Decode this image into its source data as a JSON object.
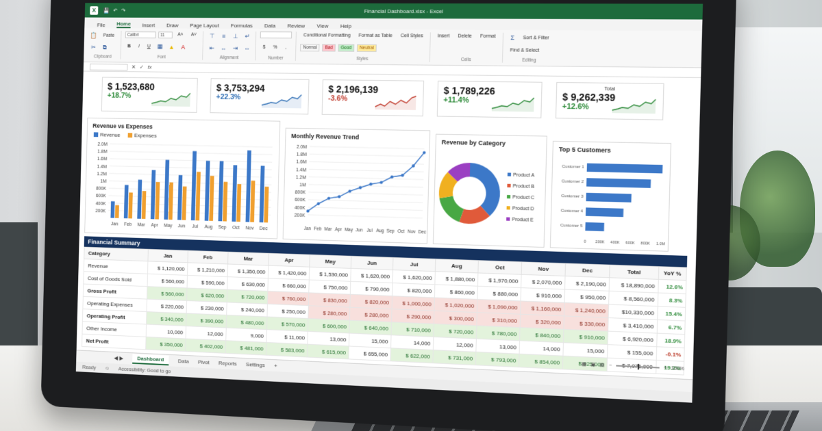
{
  "window": {
    "doc_title": "Financial Dashboard.xlsx - Excel",
    "qa_icons": [
      "save-icon",
      "undo-icon",
      "redo-icon"
    ]
  },
  "menu": [
    "File",
    "Home",
    "Insert",
    "Draw",
    "Page Layout",
    "Formulas",
    "Data",
    "Review",
    "View",
    "Help"
  ],
  "ribbon": {
    "font_name": "Calibri",
    "font_size": "11",
    "clipboard_label": "Clipboard",
    "font_label": "Font",
    "paste_label": "Paste",
    "alignment_label": "Alignment",
    "number_label": "Number",
    "styles_label": "Styles",
    "cells_label": "Cells",
    "editing_label": "Editing",
    "conditional": "Conditional Formatting",
    "format_table": "Format as Table",
    "cell_styles": "Cell Styles",
    "style_normal": "Normal",
    "style_bad": "Bad",
    "style_good": "Good",
    "style_neutral": "Neutral",
    "insert": "Insert",
    "delete": "Delete",
    "format": "Format",
    "sort": "Sort & Filter",
    "find": "Find & Select"
  },
  "formula_bar": {
    "fx": "fx"
  },
  "kpis": [
    {
      "title": "",
      "value": "$ 1,523,680",
      "change": "+18.7%",
      "trend": "up"
    },
    {
      "title": "",
      "value": "$ 3,753,294",
      "change": "+22.3%",
      "trend": "up"
    },
    {
      "title": "",
      "value": "$ 2,196,139",
      "change": "-3.6%",
      "trend": "down"
    },
    {
      "title": "",
      "value": "$ 1,789,226",
      "change": "+11.4%",
      "trend": "up"
    },
    {
      "title": "Total",
      "value": "$ 9,262,339",
      "change": "+12.6%",
      "trend": "up"
    }
  ],
  "colors": {
    "green": "#2e8b3a",
    "blue_kpi": "#2f6fb5",
    "red": "#c0392b",
    "revenue": "#3c78c8",
    "expenses": "#f0a030",
    "header_navy": "#15325e"
  },
  "chart_data": [
    {
      "type": "bar",
      "title": "Revenue vs Expenses",
      "categories": [
        "Jan",
        "Feb",
        "Mar",
        "Apr",
        "May",
        "Jun",
        "Jul",
        "Aug",
        "Sep",
        "Oct",
        "Nov",
        "Dec"
      ],
      "ylim": [
        0,
        2000000
      ],
      "yticks": [
        "2.0M",
        "1.8M",
        "1.6M",
        "1.4M",
        "1.2M",
        "1M",
        "800K",
        "600K",
        "400K",
        "200K"
      ],
      "series": [
        {
          "name": "Revenue",
          "values": [
            450000,
            900000,
            1050000,
            1320000,
            1600000,
            1200000,
            1850000,
            1600000,
            1600000,
            1500000,
            1900000,
            1500000
          ]
        },
        {
          "name": "Expenses",
          "values": [
            350000,
            700000,
            750000,
            1000000,
            1000000,
            900000,
            1300000,
            1200000,
            1050000,
            1000000,
            1100000,
            950000
          ]
        }
      ]
    },
    {
      "type": "line",
      "title": "Monthly Revenue Trend",
      "categories": [
        "Jan",
        "Feb",
        "Mar",
        "Apr",
        "May",
        "Jun",
        "Jul",
        "Aug",
        "Sep",
        "Oct",
        "Nov",
        "Dec"
      ],
      "ylim": [
        0,
        2000000
      ],
      "yticks": [
        "2.0M",
        "1.8M",
        "1.6M",
        "1.4M",
        "1.2M",
        "1M",
        "800K",
        "600K",
        "400K",
        "200K"
      ],
      "series": [
        {
          "name": "",
          "values": [
            300000,
            500000,
            650000,
            700000,
            850000,
            950000,
            1050000,
            1100000,
            1250000,
            1300000,
            1550000,
            1900000
          ]
        }
      ]
    },
    {
      "type": "pie",
      "title": "Revenue by Category",
      "labels": [
        "Product A",
        "Product B",
        "Product C",
        "Product D",
        "Product E"
      ],
      "values": [
        38,
        17,
        17,
        15,
        13
      ],
      "colors": [
        "#3c78c8",
        "#e05a3a",
        "#48a844",
        "#f0b020",
        "#9b3fc2"
      ]
    },
    {
      "type": "bar",
      "orientation": "horizontal",
      "title": "Top 5 Customers",
      "categories": [
        "Customer 1",
        "Customer 2",
        "Customer 3",
        "Customer 4",
        "Customer 5"
      ],
      "values": [
        1000000,
        850000,
        600000,
        500000,
        250000
      ],
      "xticks": [
        "0",
        "200K",
        "400K",
        "600K",
        "800K",
        "1.0M"
      ]
    }
  ],
  "summary": {
    "title": "Financial Summary",
    "headers": [
      "Category",
      "Jan",
      "Feb",
      "Mar",
      "Apr",
      "May",
      "Jun",
      "Jul",
      "Aug",
      "Oct",
      "Nov",
      "Dec",
      "Total",
      "YoY %"
    ],
    "rows": [
      {
        "label": "Revenue",
        "bold": false,
        "cells": [
          "$ 1,120,000",
          "$ 1,210,000",
          "$ 1,350,000",
          "$ 1,420,000",
          "$ 1,530,000",
          "$ 1,620,000",
          "$ 1,620,000",
          "$ 1,880,000",
          "$ 1,970,000",
          "$ 2,070,000",
          "$ 2,190,000",
          "$ 18,890,000",
          "12.6%"
        ],
        "shade": [
          "",
          "",
          "",
          "",
          "",
          "",
          "",
          "",
          "",
          "",
          "",
          "",
          "pg"
        ]
      },
      {
        "label": "Cost of Goods Sold",
        "bold": false,
        "cells": [
          "$ 560,000",
          "$ 590,000",
          "$ 630,000",
          "$ 660,000",
          "$ 750,000",
          "$ 790,000",
          "$ 820,000",
          "$ 860,000",
          "$ 880,000",
          "$ 910,000",
          "$ 950,000",
          "$ 8,560,000",
          "8.3%"
        ],
        "shade": [
          "",
          "",
          "",
          "",
          "",
          "",
          "",
          "",
          "",
          "",
          "",
          "",
          "pg"
        ]
      },
      {
        "label": "Gross Profit",
        "bold": true,
        "cells": [
          "$ 560,000",
          "$ 620,000",
          "$ 720,000",
          "$ 760,000",
          "$ 830,000",
          "$ 820,000",
          "$ 1,000,000",
          "$ 1,020,000",
          "$ 1,090,000",
          "$ 1,160,000",
          "$ 1,240,000",
          "$10,330,000",
          "15.4%"
        ],
        "shade": [
          "g",
          "g",
          "g",
          "r",
          "r",
          "r",
          "r",
          "r",
          "r",
          "r",
          "r",
          "",
          "pg"
        ]
      },
      {
        "label": "Operating Expenses",
        "bold": false,
        "cells": [
          "$ 220,000",
          "$ 230,000",
          "$ 240,000",
          "$ 250,000",
          "$ 280,000",
          "$ 280,000",
          "$ 290,000",
          "$ 300,000",
          "$ 310,000",
          "$ 320,000",
          "$ 330,000",
          "$ 3,410,000",
          "6.7%"
        ],
        "shade": [
          "",
          "",
          "",
          "",
          "r",
          "r",
          "r",
          "r",
          "r",
          "r",
          "r",
          "",
          "pg"
        ]
      },
      {
        "label": "Operating Profit",
        "bold": true,
        "cells": [
          "$ 340,000",
          "$ 390,000",
          "$ 480,000",
          "$ 570,000",
          "$ 600,000",
          "$ 640,000",
          "$ 710,000",
          "$ 720,000",
          "$ 780,000",
          "$ 840,000",
          "$ 910,000",
          "$ 6,920,000",
          "18.9%"
        ],
        "shade": [
          "g",
          "g",
          "g",
          "g",
          "g",
          "g",
          "g",
          "g",
          "g",
          "g",
          "g",
          "",
          "pg"
        ]
      },
      {
        "label": "Other Income",
        "bold": false,
        "cells": [
          "10,000",
          "12,000",
          "9,000",
          "$ 11,000",
          "13,000",
          "15,000",
          "14,000",
          "12,000",
          "13,000",
          "14,000",
          "15,000",
          "$ 155,000",
          "-0.1%"
        ],
        "shade": [
          "",
          "",
          "",
          "",
          "",
          "",
          "",
          "",
          "",
          "",
          "",
          "",
          "pr"
        ]
      },
      {
        "label": "Net Profit",
        "bold": true,
        "cells": [
          "$ 350,000",
          "$ 402,000",
          "$ 481,000",
          "$ 583,000",
          "$ 615,000",
          "$ 655,000",
          "$ 622,000",
          "$ 731,000",
          "$ 793,000",
          "$ 854,000",
          "$ 925,000",
          "$ 7,075,000",
          "19.2%"
        ],
        "shade": [
          "g",
          "g",
          "g",
          "g",
          "g",
          "",
          "g",
          "g",
          "g",
          "g",
          "g",
          "",
          "pg"
        ]
      }
    ]
  },
  "sheets": [
    "Dashboard",
    "Data",
    "Pivot",
    "Reports",
    "Settings"
  ],
  "add_sheet": "+",
  "status": {
    "ready": "Ready",
    "accessibility": "Accessibility: Good to go",
    "zoom": "100%"
  }
}
